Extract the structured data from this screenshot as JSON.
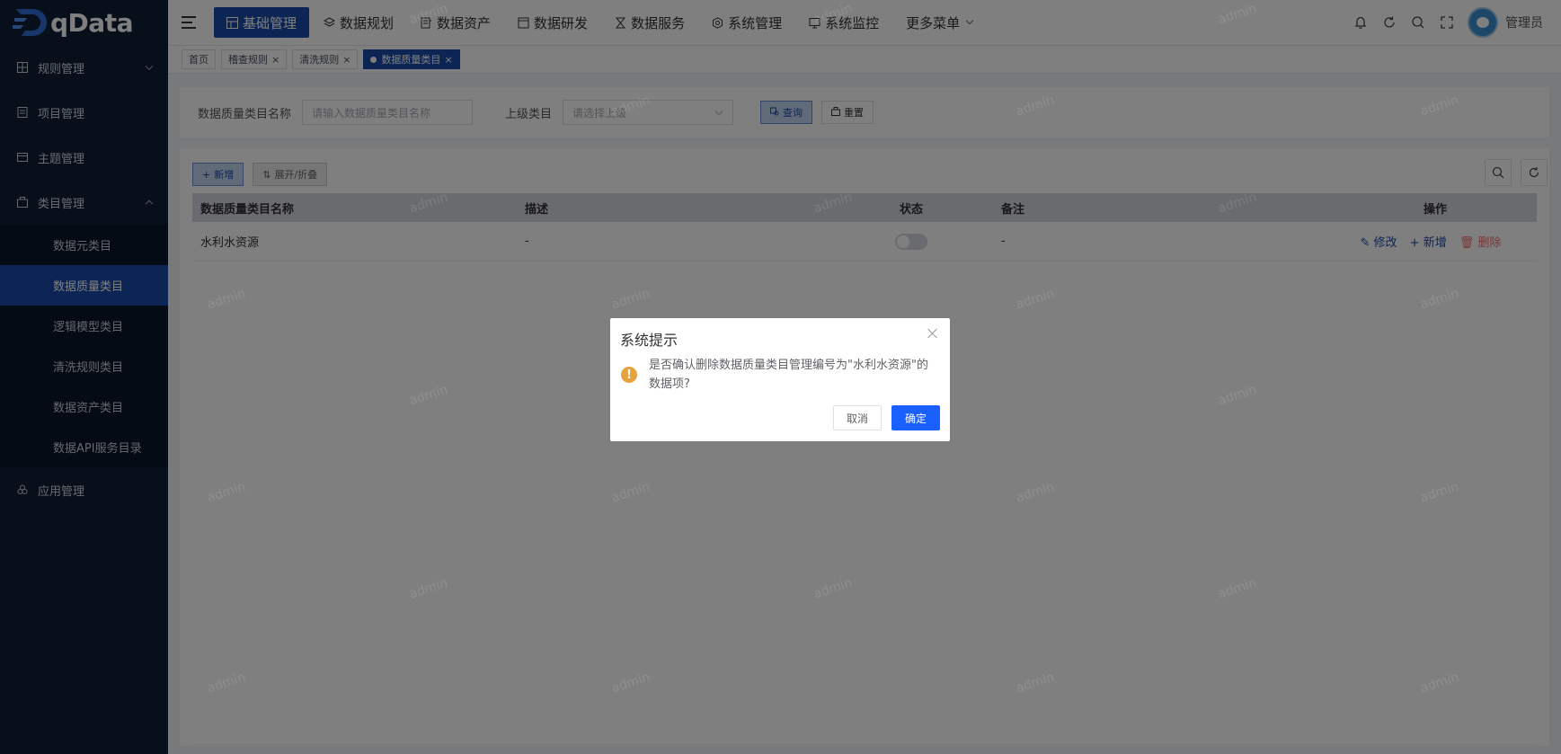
{
  "app": {
    "name": "qData"
  },
  "sidebar": {
    "items": [
      {
        "label": "规则管理",
        "icon": "grid-icon"
      },
      {
        "label": "项目管理",
        "icon": "project-icon"
      },
      {
        "label": "主题管理",
        "icon": "theme-icon"
      },
      {
        "label": "类目管理",
        "icon": "category-icon"
      },
      {
        "label": "应用管理",
        "icon": "apps-icon"
      }
    ],
    "subitems": [
      {
        "label": "数据元类目"
      },
      {
        "label": "数据质量类目"
      },
      {
        "label": "逻辑模型类目"
      },
      {
        "label": "清洗规则类目"
      },
      {
        "label": "数据资产类目"
      },
      {
        "label": "数据API服务目录"
      }
    ]
  },
  "header": {
    "nav": [
      {
        "label": "基础管理"
      },
      {
        "label": "数据规划"
      },
      {
        "label": "数据资产"
      },
      {
        "label": "数据研发"
      },
      {
        "label": "数据服务"
      },
      {
        "label": "系统管理"
      },
      {
        "label": "系统监控"
      },
      {
        "label": "更多菜单"
      }
    ],
    "username": "管理员"
  },
  "tags": [
    {
      "label": "首页"
    },
    {
      "label": "稽查规则"
    },
    {
      "label": "清洗规则"
    },
    {
      "label": "数据质量类目"
    }
  ],
  "search": {
    "name_label": "数据质量类目名称",
    "name_placeholder": "请输入数据质量类目名称",
    "parent_label": "上级类目",
    "parent_placeholder": "请选择上级",
    "query_label": "查询",
    "reset_label": "重置"
  },
  "toolbar": {
    "add_label": "新增",
    "expand_label": "展开/折叠"
  },
  "table": {
    "columns": [
      "数据质量类目名称",
      "描述",
      "状态",
      "备注",
      "操作"
    ],
    "rows": [
      {
        "name": "水利水资源",
        "desc": "-",
        "remark": "-",
        "status": false
      }
    ],
    "actions": {
      "edit": "修改",
      "add": "新增",
      "delete": "删除"
    }
  },
  "dialog": {
    "title": "系统提示",
    "message": "是否确认删除数据质量类目管理编号为\"水利水资源\"的数据项?",
    "cancel": "取消",
    "confirm": "确定"
  },
  "watermark": "admin",
  "colors": {
    "primary": "#1a4aa8",
    "sidebar": "#0f1e35",
    "confirm": "#1a5fff",
    "warning": "#e6a23c",
    "danger": "#f56c6c"
  }
}
